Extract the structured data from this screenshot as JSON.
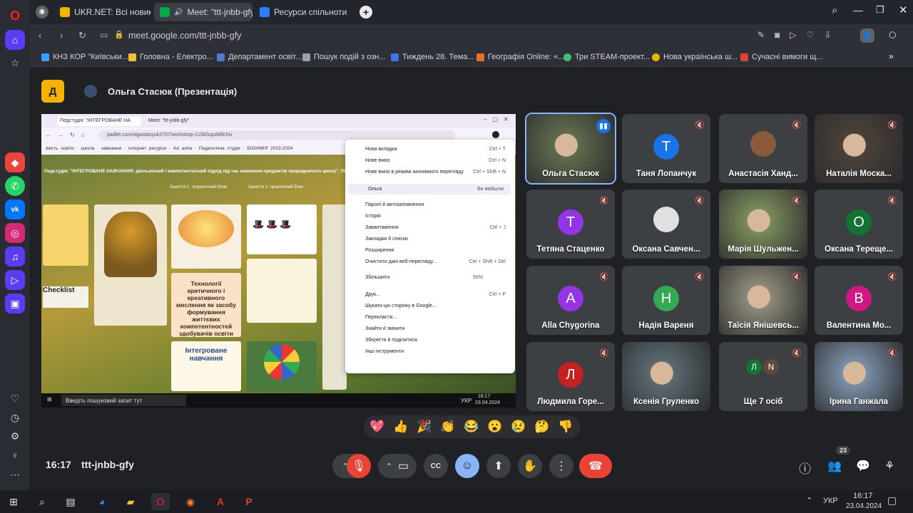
{
  "tabs": [
    {
      "label": "UKR.NET: Всі новини Укр",
      "fav": "#f5b301"
    },
    {
      "label": "Meet: \"ttt-jnbb-gfy",
      "fav": "#00ac47"
    },
    {
      "label": "Ресурси спільноти",
      "fav": "#2d7ff9"
    }
  ],
  "address": {
    "url": "meet.google.com/ttt-jnbb-gfy"
  },
  "bookmarks": [
    {
      "label": "КНЗ КОР \"Київськи...",
      "color": "#3aa0ff"
    },
    {
      "label": "Головна - Електро...",
      "color": "#f2c230"
    },
    {
      "label": "Департамент освіт...",
      "color": "#4a7bd0"
    },
    {
      "label": "Пошук подій з озн...",
      "color": "#9aa0a6"
    },
    {
      "label": "Тиждень 28. Тема...",
      "color": "#3b78e7"
    },
    {
      "label": "Географія Online: «...",
      "color": "#e8702a"
    },
    {
      "label": "Три STEAM-проект...",
      "color": "#3ec46d"
    },
    {
      "label": "Нова українська ш...",
      "color": "#f0b400"
    },
    {
      "label": "Сучасні вимоги щ...",
      "color": "#e0442f"
    }
  ],
  "presenter": {
    "name": "Ольга Стасюк (Презентація)"
  },
  "share": {
    "tabs": [
      "Педстудія: \"ІНТЕГРОВАНЕ НА",
      "Meet: \"ttt-jnbb-gfy\""
    ],
    "url": "padlet.com/olgastasyuk2707/workshop-215k0upzb6fchiv",
    "bookmarks": [
      "якість освіти",
      "школа",
      "навчання",
      "інтернет ресурси",
      "Ad astra",
      "Педагогічна студія",
      "БІОХІМІЯ 2023-2024"
    ],
    "heading": "Педстудія: \"ІНТЕГРОВАНЕ НАВЧАННЯ: діяльнісний і компетентнісний підхід під час вивчення предметів природничого циклу\". ПРИРОД",
    "columns": [
      "Заняття 1: теоретичний блок",
      "Заняття 1: практичний блок"
    ],
    "cards": [
      "Технології критичного і креативного мислення як засобу формування життєвих компетентностей здобувачів освіти",
      "Інтегроване навчання",
      "Checklist"
    ],
    "menu": [
      {
        "label": "Нова вкладка",
        "sc": "Ctrl + T"
      },
      {
        "label": "Нове вікно",
        "sc": "Ctrl + N"
      },
      {
        "label": "Нове вікно в режимі анонімного перегляду",
        "sc": "Ctrl + Shift + N"
      },
      {
        "label": "Ольга",
        "sc": "Ви ввійшли"
      },
      {
        "label": "Паролі й автозаповнення",
        "sc": ""
      },
      {
        "label": "Історія",
        "sc": ""
      },
      {
        "label": "Завантаження",
        "sc": "Ctrl + J"
      },
      {
        "label": "Закладки й списки",
        "sc": ""
      },
      {
        "label": "Розширення",
        "sc": ""
      },
      {
        "label": "Очистити дані веб-перегляду...",
        "sc": "Ctrl + Shift + Del"
      },
      {
        "label": "Збільшити",
        "sc": "50%"
      },
      {
        "label": "Друк...",
        "sc": "Ctrl + P"
      },
      {
        "label": "Шукати цю сторінку в Google...",
        "sc": ""
      },
      {
        "label": "Перекласти...",
        "sc": ""
      },
      {
        "label": "Знайти й змінити",
        "sc": ""
      },
      {
        "label": "Зберегти й поділитися",
        "sc": ""
      },
      {
        "label": "Інші інструменти",
        "sc": ""
      }
    ],
    "taskbar": {
      "search": "Введіть пошуковий запит тут",
      "lang": "УКР",
      "time": "16:17",
      "date": "23.04.2024"
    }
  },
  "participants": [
    {
      "name": "Ольга Стасюк",
      "initial": "",
      "color": "#5f6b4d",
      "video": true
    },
    {
      "name": "Таня Лопанчук",
      "initial": "T",
      "color": "#1a73e8"
    },
    {
      "name": "Анастасія Ханд...",
      "initial": "",
      "color": "#8a5b3a",
      "avatar": true
    },
    {
      "name": "Наталія Моска...",
      "initial": "",
      "color": "#4a4038",
      "video": true
    },
    {
      "name": "Тетяна Стаценко",
      "initial": "T",
      "color": "#9334e6"
    },
    {
      "name": "Оксана Савчен...",
      "initial": "",
      "color": "#e0e0e0",
      "avatar": true
    },
    {
      "name": "Марія Шульжен...",
      "initial": "",
      "color": "#7a8b5a",
      "video": true
    },
    {
      "name": "Оксана Терещe...",
      "initial": "O",
      "color": "#137333"
    },
    {
      "name": "Alla Chygorina",
      "initial": "A",
      "color": "#9334e6"
    },
    {
      "name": "Надія Вареня",
      "initial": "H",
      "color": "#34a853"
    },
    {
      "name": "Таїсія Янішевсь...",
      "initial": "",
      "color": "#8c8a78",
      "video": true
    },
    {
      "name": "Валентина Мо...",
      "initial": "B",
      "color": "#d01884"
    },
    {
      "name": "Людмила Горе...",
      "initial": "Л",
      "color": "#c5221f"
    },
    {
      "name": "Ксенія Груленко",
      "initial": "",
      "color": "#5b6a6f",
      "video": true
    },
    {
      "name": "Ще 7 осіб",
      "initial": "",
      "color": "#3c4043",
      "more": [
        "Л",
        "N"
      ]
    },
    {
      "name": "Ірина Ганжала",
      "initial": "",
      "color": "#7b8fa6",
      "video": true
    }
  ],
  "reactions": [
    "💖",
    "👍",
    "🎉",
    "👏",
    "😂",
    "😮",
    "😢",
    "🤔",
    "👎"
  ],
  "meeting": {
    "time": "16:17",
    "code": "ttt-jnbb-gfy",
    "people_count": "23"
  },
  "os_taskbar": {
    "lang": "УКР",
    "time": "16:17",
    "date": "23.04.2024"
  },
  "colors": {
    "end_call": "#ea4335",
    "mic_off": "#ea4335",
    "reaction_active": "#8ab4f8",
    "presenter_badge": "#f5b301"
  }
}
